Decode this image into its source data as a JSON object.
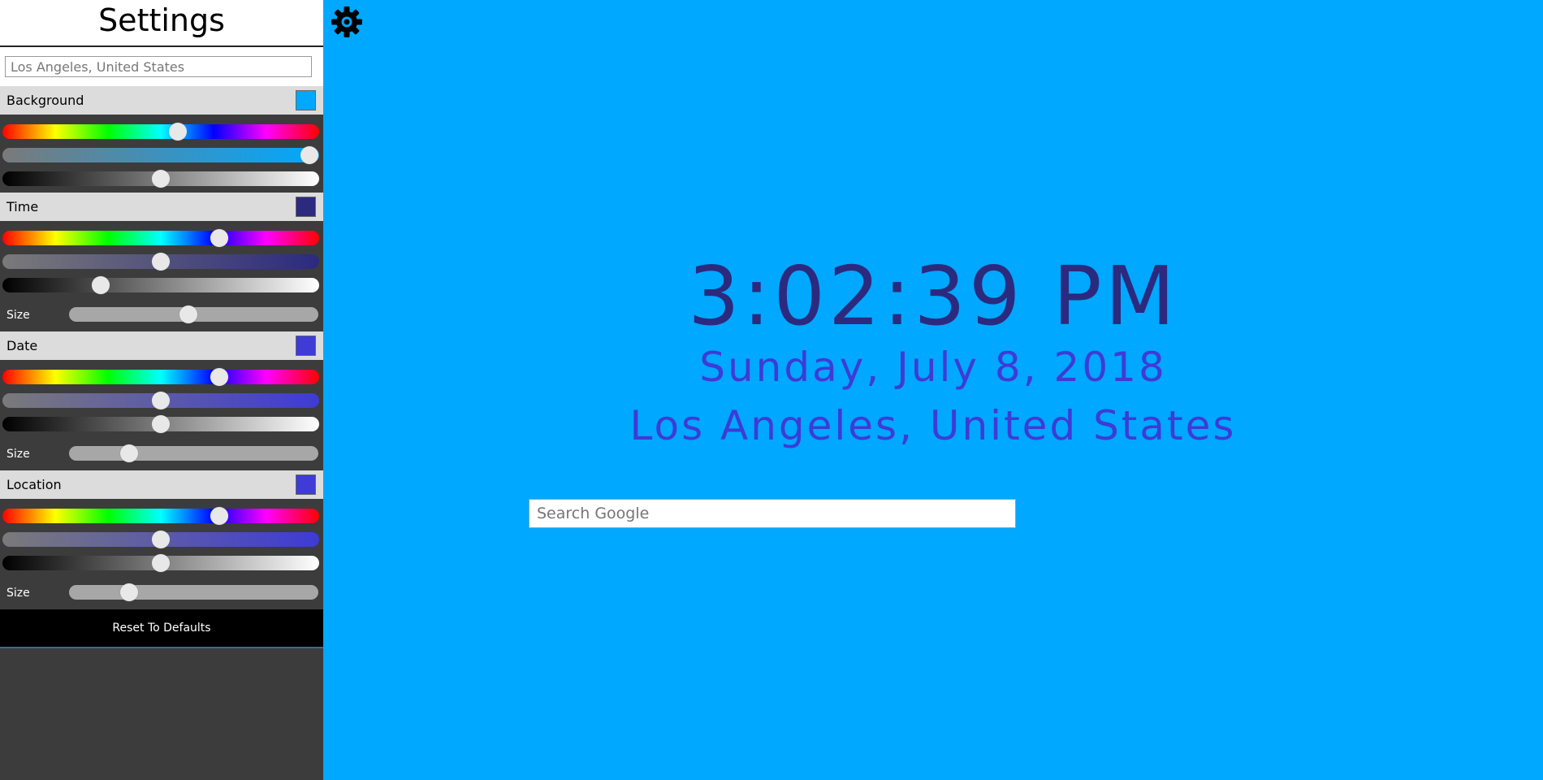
{
  "sidebar": {
    "title": "Settings",
    "location_placeholder": "Los Angeles, United States",
    "sections": [
      {
        "label": "Background",
        "color": "#00a8ff",
        "hue": 0.555,
        "saturation": 0.97,
        "lightness": 0.5
      },
      {
        "label": "Time",
        "color": "#2c2a7e",
        "hue": 0.685,
        "saturation": 0.5,
        "lightness": 0.31,
        "size_label": "Size",
        "size": 0.48
      },
      {
        "label": "Date",
        "color": "#3e3bd6",
        "hue": 0.685,
        "saturation": 0.5,
        "lightness": 0.5,
        "size_label": "Size",
        "size": 0.24
      },
      {
        "label": "Location",
        "color": "#3e3bd6",
        "hue": 0.685,
        "saturation": 0.5,
        "lightness": 0.5,
        "size_label": "Size",
        "size": 0.24
      }
    ],
    "reset_label": "Reset To Defaults"
  },
  "main": {
    "time": "3:02:39 PM",
    "date": "Sunday, July 8, 2018",
    "location": "Los Angeles, United States",
    "search_placeholder": "Search Google",
    "settings_icon": "gear-icon"
  }
}
